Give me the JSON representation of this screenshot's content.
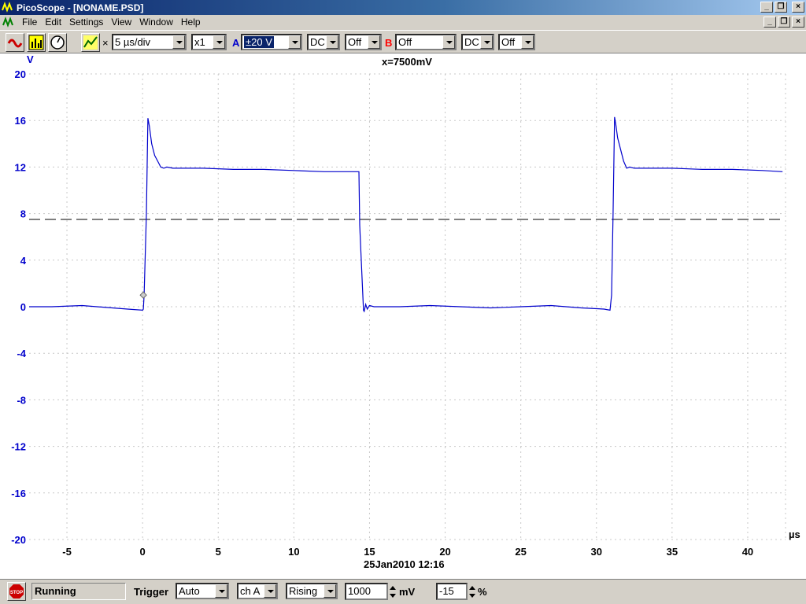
{
  "window": {
    "title": "PicoScope - [NONAME.PSD]"
  },
  "menu": {
    "items": [
      "File",
      "Edit",
      "Settings",
      "View",
      "Window",
      "Help"
    ]
  },
  "toolbar": {
    "timebase": "5 µs/div",
    "multiplier": "x1",
    "channel_a": {
      "label": "A",
      "range": "±20 V",
      "coupling": "DC",
      "option": "Off",
      "color": "#0000cc"
    },
    "channel_b": {
      "label": "B",
      "range": "Off",
      "coupling": "DC",
      "option": "Off",
      "color": "#ff0000"
    }
  },
  "chart_data": {
    "type": "line",
    "title": "",
    "xlabel": "µs",
    "ylabel": "V",
    "xlim": [
      -7.5,
      42.5
    ],
    "ylim": [
      -20,
      20
    ],
    "xticks": [
      -5,
      0,
      5,
      10,
      15,
      20,
      25,
      30,
      35,
      40
    ],
    "yticks": [
      20,
      16,
      12,
      8,
      4,
      0,
      -4,
      -8,
      -12,
      -16,
      -20
    ],
    "grid": true,
    "annotation": "x=7500mV",
    "trigger_level": 7.5,
    "trigger_marker": {
      "x": 0.05,
      "y": 1.0
    },
    "timestamp": "25Jan2010  12:16",
    "series": [
      {
        "color": "#0000cc",
        "x": [
          -7.5,
          -6,
          -4,
          -2,
          -1,
          0.0,
          0.05,
          0.1,
          0.25,
          0.35,
          0.45,
          0.6,
          0.8,
          1.0,
          1.2,
          1.4,
          1.6,
          2,
          4,
          6,
          8,
          10,
          12,
          14,
          14.3,
          14.35,
          14.6,
          14.65,
          14.75,
          14.85,
          15.0,
          15.3,
          17,
          19,
          21,
          23,
          25,
          27,
          29,
          30.5,
          30.9,
          31.0,
          31.1,
          31.2,
          31.3,
          31.4,
          31.6,
          31.8,
          32.0,
          32.2,
          32.5,
          33,
          35,
          37,
          39,
          41,
          42.3
        ],
        "y": [
          0.0,
          0.0,
          0.1,
          -0.1,
          -0.2,
          -0.3,
          -0.2,
          1.0,
          8.0,
          16.2,
          15.5,
          14.0,
          13.0,
          12.5,
          12.0,
          11.9,
          12.0,
          11.9,
          11.9,
          11.8,
          11.8,
          11.7,
          11.6,
          11.6,
          11.6,
          7.0,
          -0.3,
          -0.4,
          0.2,
          -0.2,
          0.1,
          0.0,
          0.0,
          0.1,
          0.0,
          -0.1,
          0.0,
          0.1,
          -0.1,
          -0.2,
          -0.3,
          1.0,
          8.0,
          16.3,
          15.5,
          14.5,
          13.5,
          12.5,
          11.9,
          12.0,
          11.9,
          11.9,
          11.9,
          11.8,
          11.8,
          11.7,
          11.6
        ]
      }
    ]
  },
  "status": {
    "run_state": "Running",
    "trigger_label": "Trigger",
    "trigger_mode": "Auto",
    "trigger_channel": "ch A",
    "trigger_edge": "Rising",
    "trigger_level": "1000",
    "trigger_level_unit": "mV",
    "pre_trigger": "-15",
    "pre_trigger_unit": "%"
  }
}
